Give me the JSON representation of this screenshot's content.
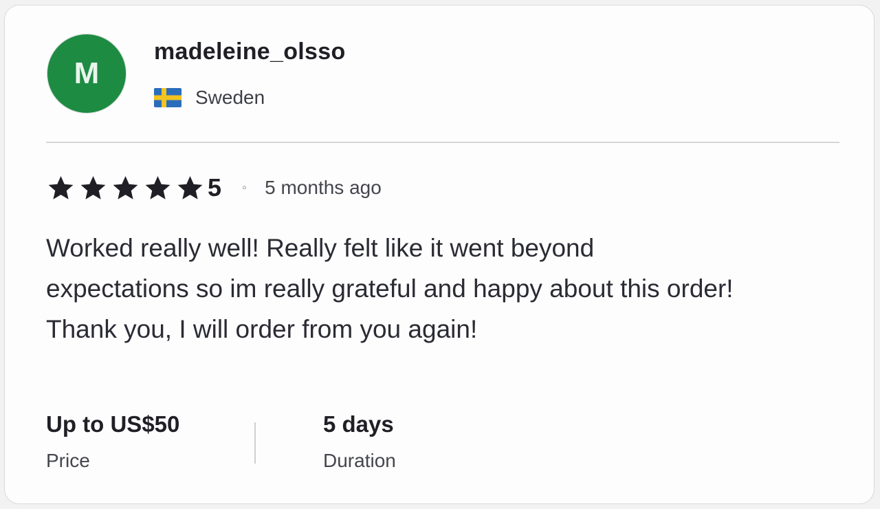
{
  "reviewer": {
    "avatar_initial": "M",
    "avatar_color": "#1e8b43",
    "username": "madeleine_olsso",
    "country": "Sweden",
    "flag_icon": "sweden-flag-icon",
    "flag_colors": {
      "blue": "#2a6ebb",
      "yellow": "#f3c320"
    }
  },
  "review": {
    "star_count": 5,
    "rating": "5",
    "separator": "◦",
    "time_ago": "5 months ago",
    "text": "Worked really well! Really felt like it went beyond\nexpectations so im really grateful and happy about this order!\nThank you, I will order from you again!"
  },
  "details": {
    "price_value": "Up to US$50",
    "price_label": "Price",
    "duration_value": "5 days",
    "duration_label": "Duration"
  }
}
